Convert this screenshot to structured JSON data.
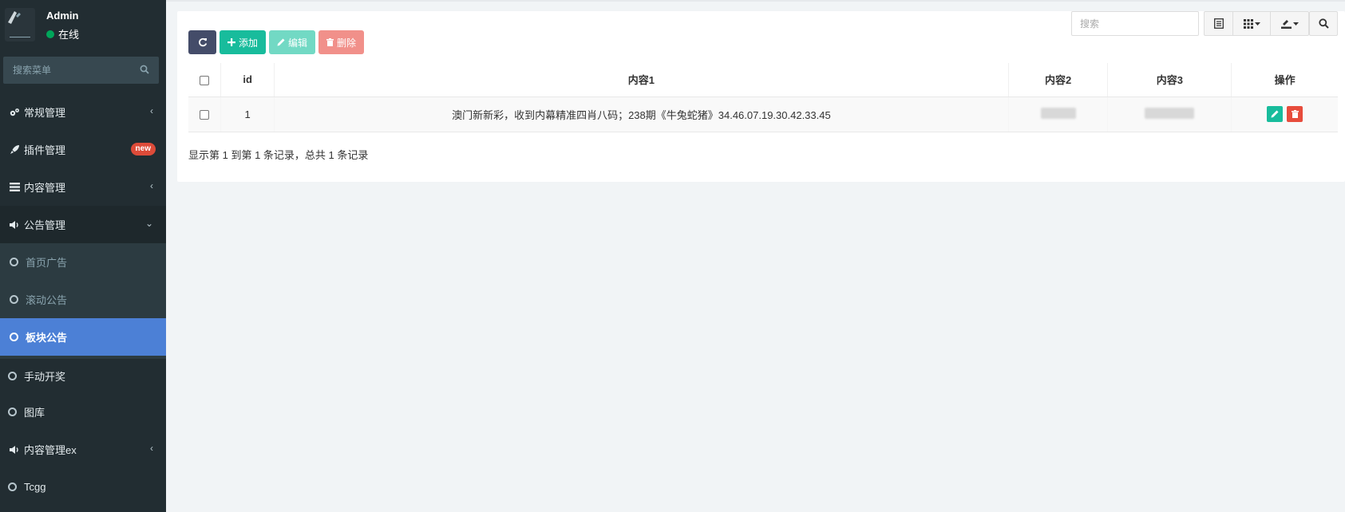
{
  "user": {
    "name": "Admin",
    "status": "在线"
  },
  "menu_search": {
    "placeholder": "搜索菜单"
  },
  "menu": {
    "regular": "常规管理",
    "plugins": "插件管理",
    "plugins_badge": "new",
    "content": "内容管理",
    "notice": "公告管理",
    "notice_sub": [
      "首页广告",
      "滚动公告",
      "板块公告"
    ],
    "manual_draw": "手动开奖",
    "gallery": "图库",
    "content_ex": "内容管理ex",
    "tcgg": "Tcgg"
  },
  "toolbar": {
    "add": "添加",
    "edit": "编辑",
    "delete": "删除"
  },
  "search": {
    "placeholder": "搜索"
  },
  "table": {
    "headers": {
      "id": "id",
      "c1": "内容1",
      "c2": "内容2",
      "c3": "内容3",
      "ops": "操作"
    },
    "rows": [
      {
        "id": "1",
        "c1": "澳门新新彩，收到内幕精准四肖八码；238期《牛兔蛇猪》34.46.07.19.30.42.33.45"
      }
    ]
  },
  "pagination": {
    "info": "显示第 1 到第 1 条记录，总共 1 条记录"
  },
  "colors": {
    "sidebar_bg": "#222d32",
    "active": "#4c80d6",
    "success": "#18bc9c",
    "danger": "#e74c3c",
    "online": "#00a65a"
  }
}
